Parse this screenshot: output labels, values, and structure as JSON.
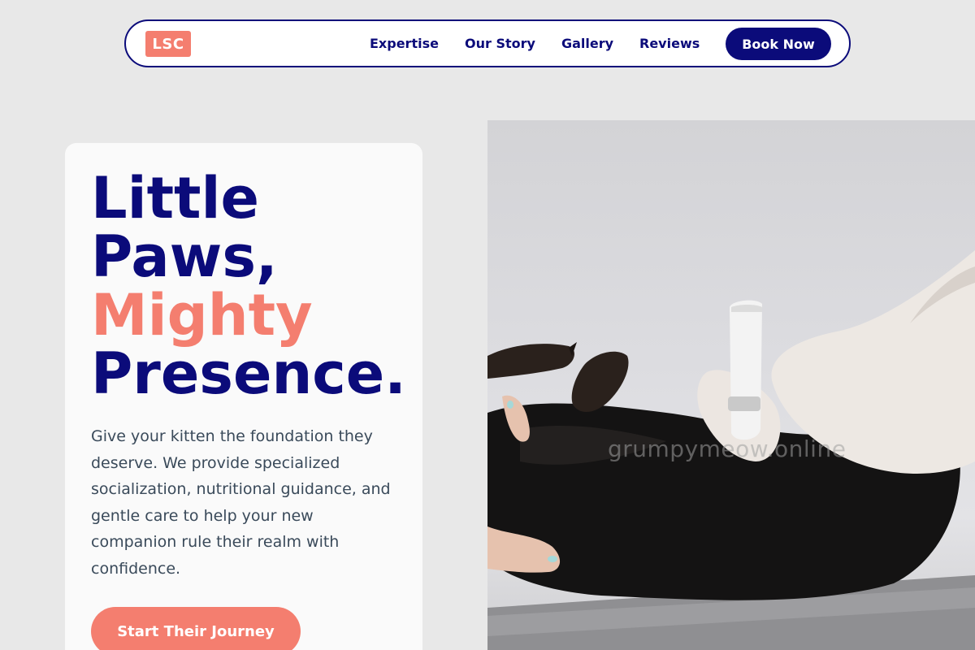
{
  "nav": {
    "logo": "LSC",
    "links": [
      "Expertise",
      "Our Story",
      "Gallery",
      "Reviews"
    ],
    "book_label": "Book Now"
  },
  "hero": {
    "headline_line1": "Little",
    "headline_line2": "Paws,",
    "headline_accent": "Mighty",
    "headline_line4": "Presence.",
    "description": "Give your kitten the foundation they deserve. We provide specialized socialization, nutritional guidance, and gentle care to help your new companion rule their realm with confidence.",
    "cta_label": "Start Their Journey"
  },
  "image": {
    "watermark": "grumpymeow.online"
  },
  "colors": {
    "navy": "#0b0b7a",
    "coral": "#f47e6f",
    "background": "#e8e8e8"
  }
}
